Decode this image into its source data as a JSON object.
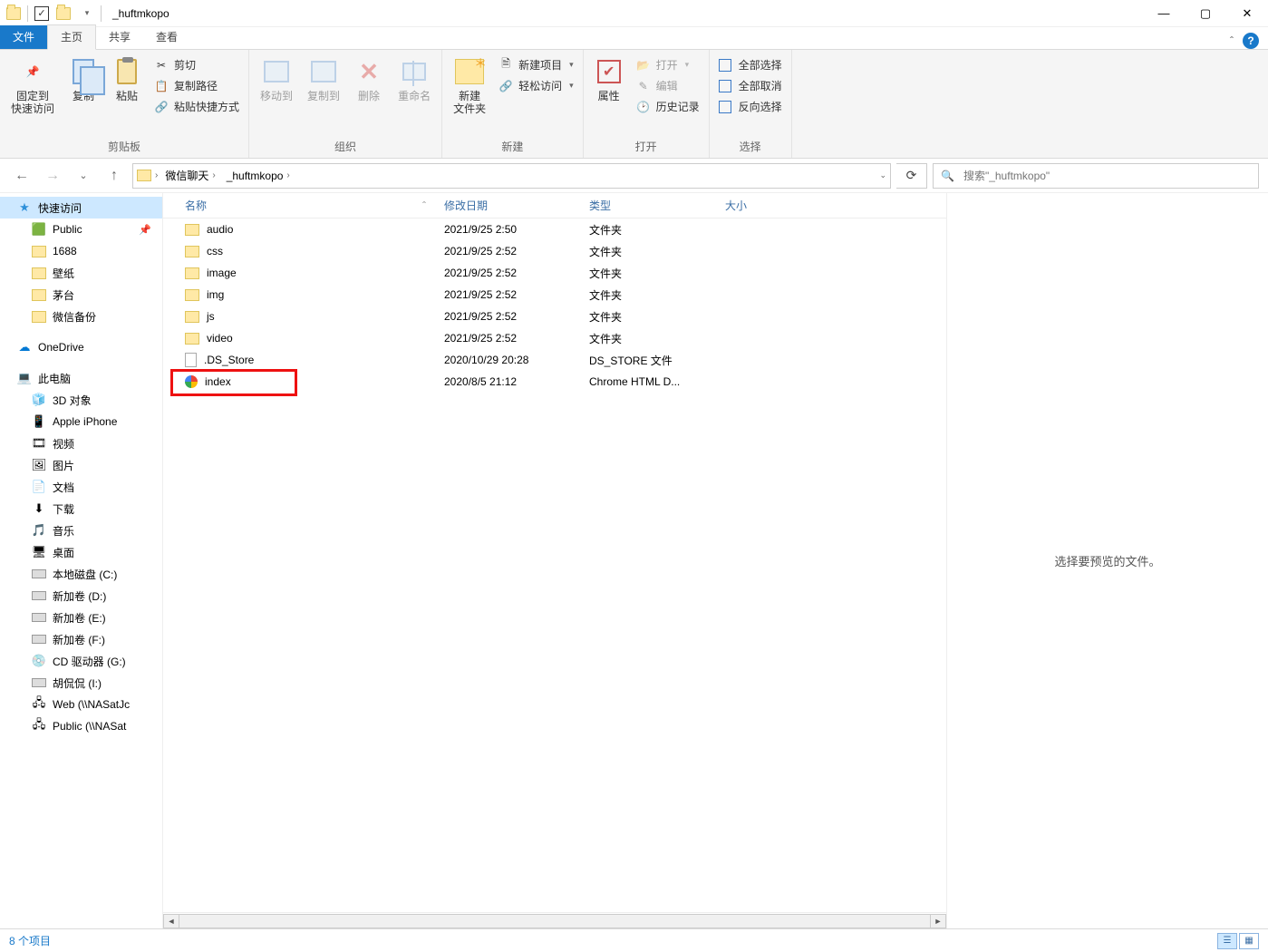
{
  "title": "_huftmkopo",
  "tabs": {
    "file": "文件",
    "home": "主页",
    "share": "共享",
    "view": "查看"
  },
  "ribbon": {
    "clipboard": {
      "pin": "固定到\n快速访问",
      "copy": "复制",
      "paste": "粘贴",
      "cut": "剪切",
      "copypath": "复制路径",
      "pasteshort": "粘贴快捷方式",
      "label": "剪贴板"
    },
    "organize": {
      "moveto": "移动到",
      "copyto": "复制到",
      "delete": "删除",
      "rename": "重命名",
      "label": "组织"
    },
    "new_": {
      "newfolder": "新建\n文件夹",
      "newitem": "新建项目",
      "easyaccess": "轻松访问",
      "label": "新建"
    },
    "open": {
      "properties": "属性",
      "open": "打开",
      "edit": "编辑",
      "history": "历史记录",
      "label": "打开"
    },
    "select": {
      "all": "全部选择",
      "none": "全部取消",
      "invert": "反向选择",
      "label": "选择"
    }
  },
  "breadcrumbs": [
    "微信聊天",
    "_huftmkopo"
  ],
  "search_placeholder": "搜索\"_huftmkopo\"",
  "columns": {
    "name": "名称",
    "date": "修改日期",
    "type": "类型",
    "size": "大小"
  },
  "files": [
    {
      "icon": "folder",
      "name": "audio",
      "date": "2021/9/25 2:50",
      "type": "文件夹"
    },
    {
      "icon": "folder",
      "name": "css",
      "date": "2021/9/25 2:52",
      "type": "文件夹"
    },
    {
      "icon": "folder",
      "name": "image",
      "date": "2021/9/25 2:52",
      "type": "文件夹"
    },
    {
      "icon": "folder",
      "name": "img",
      "date": "2021/9/25 2:52",
      "type": "文件夹"
    },
    {
      "icon": "folder",
      "name": "js",
      "date": "2021/9/25 2:52",
      "type": "文件夹"
    },
    {
      "icon": "folder",
      "name": "video",
      "date": "2021/9/25 2:52",
      "type": "文件夹"
    },
    {
      "icon": "file",
      "name": ".DS_Store",
      "date": "2020/10/29 20:28",
      "type": "DS_STORE 文件"
    },
    {
      "icon": "html",
      "name": "index",
      "date": "2020/8/5 21:12",
      "type": "Chrome HTML D...",
      "highlight": true
    }
  ],
  "nav": {
    "quick": {
      "label": "快速访问",
      "items": [
        {
          "icon": "pub",
          "label": "Public",
          "pinned": true
        },
        {
          "icon": "folder",
          "label": "1688"
        },
        {
          "icon": "folder",
          "label": "壁纸"
        },
        {
          "icon": "folder",
          "label": "茅台"
        },
        {
          "icon": "folder",
          "label": "微信备份"
        }
      ]
    },
    "onedrive": "OneDrive",
    "thispc": {
      "label": "此电脑",
      "items": [
        {
          "icon": "3d",
          "label": "3D 对象"
        },
        {
          "icon": "phone",
          "label": "Apple iPhone"
        },
        {
          "icon": "video",
          "label": "视频"
        },
        {
          "icon": "pic",
          "label": "图片"
        },
        {
          "icon": "doc",
          "label": "文档"
        },
        {
          "icon": "dl",
          "label": "下载"
        },
        {
          "icon": "music",
          "label": "音乐"
        },
        {
          "icon": "desk",
          "label": "桌面"
        },
        {
          "icon": "disk",
          "label": "本地磁盘 (C:)"
        },
        {
          "icon": "disk",
          "label": "新加卷 (D:)"
        },
        {
          "icon": "disk",
          "label": "新加卷 (E:)"
        },
        {
          "icon": "disk",
          "label": "新加卷 (F:)"
        },
        {
          "icon": "cd",
          "label": "CD 驱动器 (G:)"
        },
        {
          "icon": "disk",
          "label": "胡侃侃 (I:)"
        },
        {
          "icon": "net",
          "label": "Web (\\\\NASatJc"
        },
        {
          "icon": "net",
          "label": "Public (\\\\NASat"
        }
      ]
    }
  },
  "preview_text": "选择要预览的文件。",
  "status_text": "8 个项目"
}
